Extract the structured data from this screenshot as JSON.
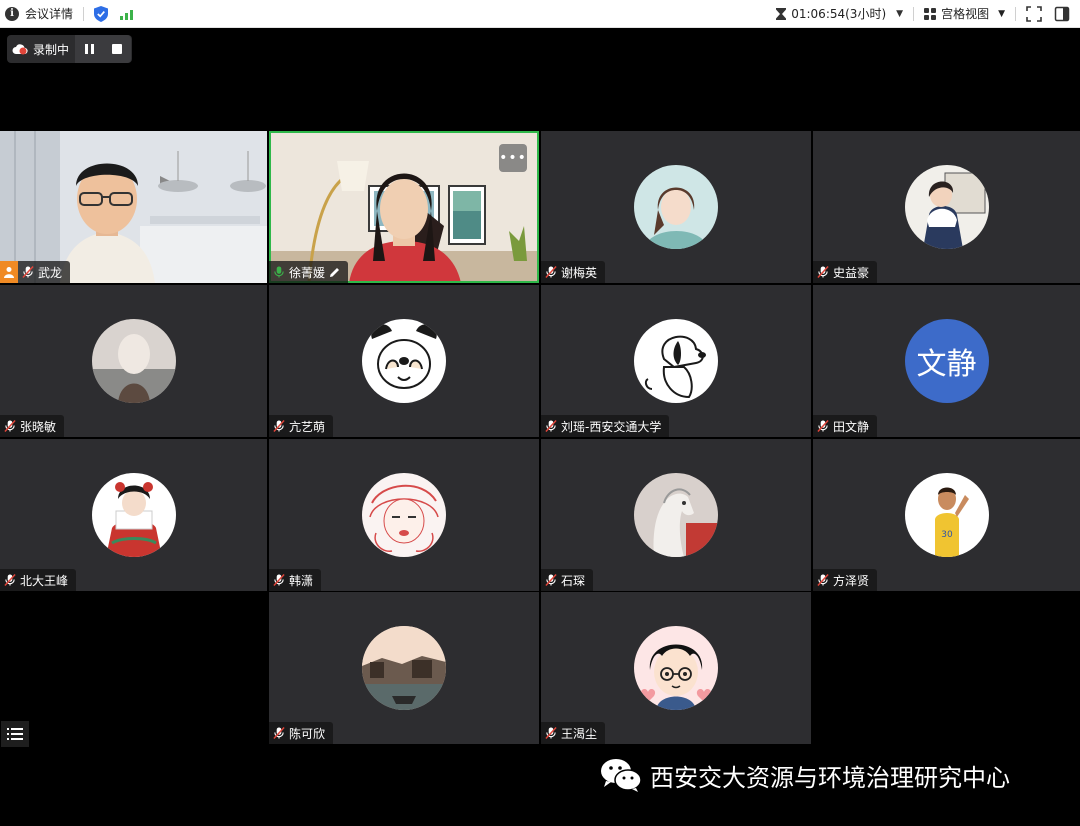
{
  "topbar": {
    "meeting_details_label": "会议详情",
    "duration": "01:06:54(3小时)",
    "view_mode_label": "宫格视图"
  },
  "recording": {
    "status_label": "录制中"
  },
  "participants": [
    {
      "name": "武龙",
      "host": true,
      "video": true
    },
    {
      "name": "徐菁媛",
      "speaking": true,
      "video": true
    },
    {
      "name": "谢梅英"
    },
    {
      "name": "史益豪"
    },
    {
      "name": "张晓敏"
    },
    {
      "name": "亢艺萌"
    },
    {
      "name": "刘瑶-西安交通大学"
    },
    {
      "name": "田文静",
      "avatar_text": "文静",
      "avatar_color": "#3d6bc9"
    },
    {
      "name": "北大王峰"
    },
    {
      "name": "韩潇"
    },
    {
      "name": "石琛"
    },
    {
      "name": "方泽贤"
    },
    {
      "name": "陈可欣"
    },
    {
      "name": "王渴尘"
    }
  ],
  "watermark": {
    "text": "西安交大资源与环境治理研究中心"
  },
  "colors": {
    "active_border": "#2fb84a",
    "mic_on": "#3cb24a",
    "mic_muted": "#e0453a",
    "tile_bg": "#2d2d30"
  },
  "icons": [
    "info-icon",
    "shield-icon",
    "signal-icon",
    "hourglass-icon",
    "chevron-down-icon",
    "grid-icon",
    "fullscreen-icon",
    "sidebar-icon",
    "cloud-record-icon",
    "pause-icon",
    "stop-icon",
    "mic-muted-icon",
    "mic-on-icon",
    "pencil-icon",
    "more-icon",
    "list-menu-icon",
    "wechat-icon",
    "host-icon"
  ]
}
